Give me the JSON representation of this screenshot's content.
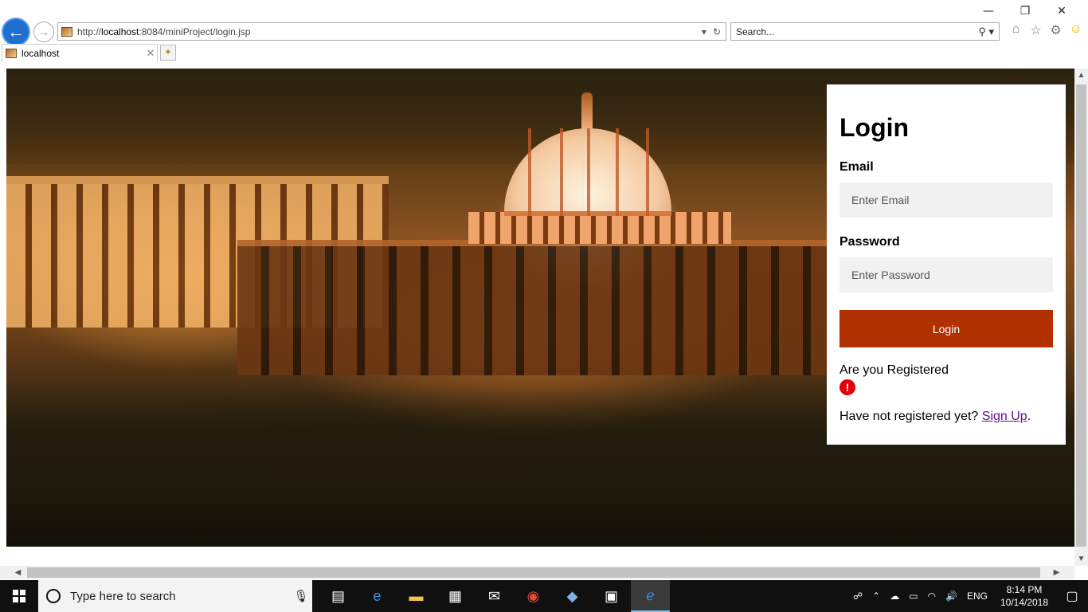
{
  "browser": {
    "window_controls": {
      "minimize": "—",
      "restore": "❐",
      "close": "✕"
    },
    "address": {
      "prefix": "http://",
      "host": "localhost",
      "rest": ":8084/miniProject/login.jsp"
    },
    "search": {
      "placeholder": "Search..."
    },
    "tab": {
      "label": "localhost"
    }
  },
  "login": {
    "title": "Login",
    "email_label": "Email",
    "email_placeholder": "Enter Email",
    "password_label": "Password",
    "password_placeholder": "Enter Password",
    "button_label": "Login",
    "status_text": "Are you Registered",
    "error_icon_glyph": "!",
    "signup_prefix": "Have not registered yet? ",
    "signup_link": "Sign Up",
    "signup_suffix": "."
  },
  "taskbar": {
    "search_placeholder": "Type here to search",
    "language": "ENG",
    "time": "8:14 PM",
    "date": "10/14/2018"
  },
  "colors": {
    "login_button": "#b13000",
    "link": "#6a0a8a",
    "error": "#e3000b",
    "taskbar": "#101010"
  }
}
